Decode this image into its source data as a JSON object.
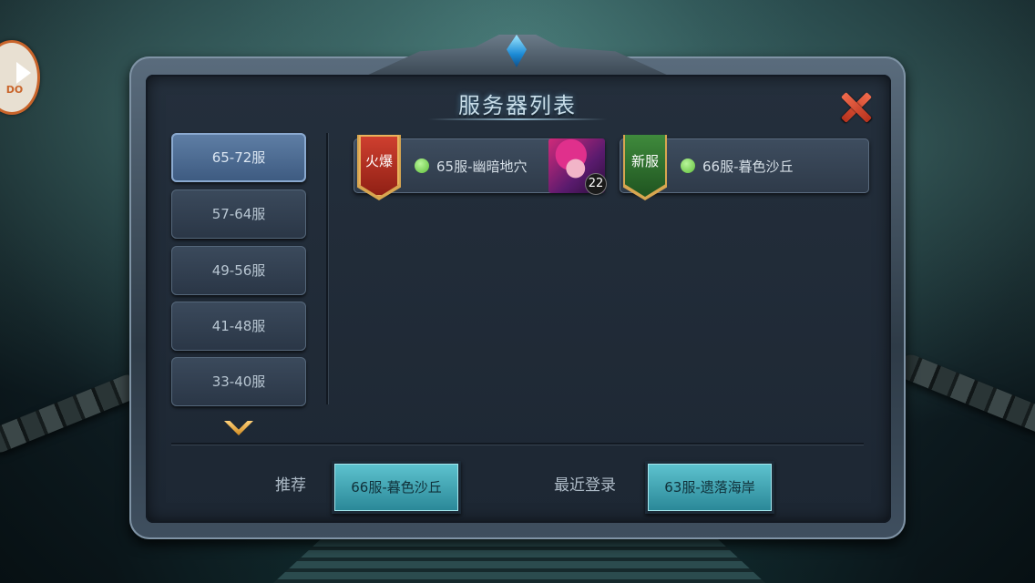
{
  "logo": {
    "text": "DO"
  },
  "dialog": {
    "title": "服务器列表"
  },
  "range_tabs": [
    {
      "label": "65-72服",
      "active": true
    },
    {
      "label": "57-64服",
      "active": false
    },
    {
      "label": "49-56服",
      "active": false
    },
    {
      "label": "41-48服",
      "active": false
    },
    {
      "label": "33-40服",
      "active": false
    }
  ],
  "servers": [
    {
      "badge": "火爆",
      "name": "65服-幽暗地穴",
      "status": "online",
      "character_level": "22"
    },
    {
      "badge": "新服",
      "name": "66服-暮色沙丘",
      "status": "online"
    }
  ],
  "footer": {
    "recommend_label": "推荐",
    "recommend_server": "66服-暮色沙丘",
    "recent_label": "最近登录",
    "recent_server": "63服-遗落海岸"
  },
  "colors": {
    "hot_badge": "#b8321d",
    "new_badge": "#2f6f2e",
    "online_dot": "#7fd35a",
    "active_tab": "#4d6d94",
    "server_button": "#3fa5b4"
  }
}
